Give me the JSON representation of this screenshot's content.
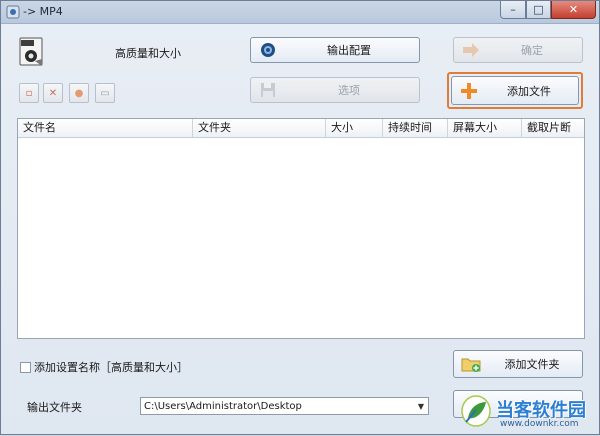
{
  "window": {
    "title": "-> MP4",
    "close": "✕",
    "minimize": "–",
    "maximize": "□"
  },
  "preset": {
    "label": "高质量和大小"
  },
  "toolbar": {
    "output_config": "输出配置",
    "ok": "确定",
    "options": "选项",
    "add_file": "添加文件",
    "add_folder": "添加文件夹"
  },
  "table": {
    "columns": [
      "文件名",
      "文件夹",
      "大小",
      "持续时间",
      "屏幕大小",
      "截取片断"
    ]
  },
  "footer": {
    "add_setting_name": "添加设置名称［高质量和大小］",
    "output_folder_label": "输出文件夹",
    "output_folder_value": "C:\\Users\\Administrator\\Desktop"
  },
  "watermark": {
    "brand": "当客软件园",
    "url": "www.downkr.com"
  },
  "colors": {
    "highlight": "#e07b3a",
    "close": "#c43f2e",
    "accent": "#2d7fd3"
  }
}
